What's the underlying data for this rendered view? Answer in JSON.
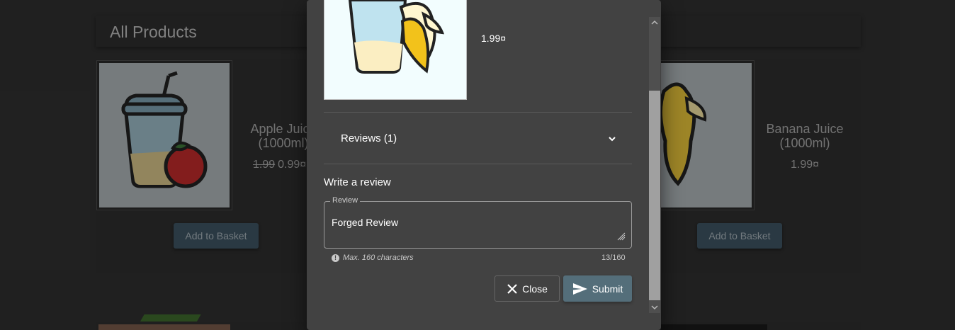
{
  "page": {
    "title": "All Products"
  },
  "products": [
    {
      "name": "Apple Juice (1000ml)",
      "old_price": "1.99",
      "price": "0.99¤",
      "button": "Add to Basket"
    },
    {
      "name": "Banana Juice (1000ml)",
      "price": "1.99¤",
      "button": "Add to Basket"
    }
  ],
  "dialog": {
    "price": "1.99¤",
    "reviews_label": "Reviews (1)",
    "write_review_label": "Write a review",
    "review_field": {
      "legend": "Review",
      "value": "Forged Review",
      "hint": "Max. 160 characters",
      "counter": "13/160"
    },
    "close_button": "Close",
    "submit_button": "Submit"
  },
  "colors": {
    "background": "#303030",
    "dialog": "#424242",
    "accent": "#546e7a",
    "basket_button": "#3e5563"
  }
}
